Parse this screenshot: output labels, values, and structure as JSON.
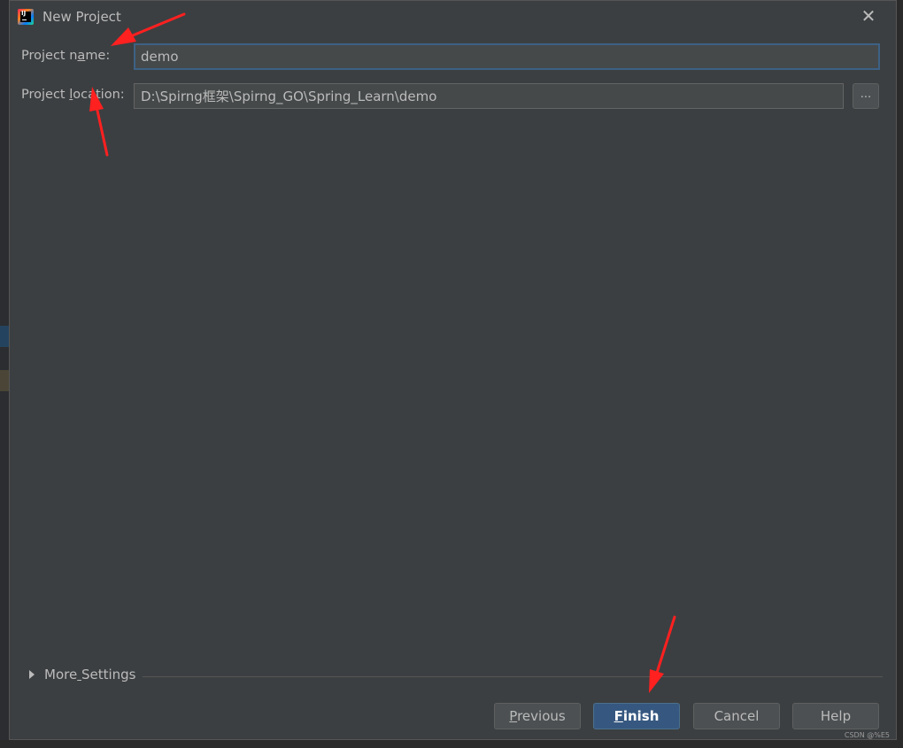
{
  "window": {
    "title": "New Project",
    "close_icon": "close-icon"
  },
  "form": {
    "project_name_label_pre": "Project n",
    "project_name_label_mnemonic": "a",
    "project_name_label_post": "me:",
    "project_name_value": "demo",
    "project_location_label_pre": "Project ",
    "project_location_label_mnemonic": "l",
    "project_location_label_post": "ocation:",
    "project_location_value": "D:\\Spirng框架\\Spirng_GO\\Spring_Learn\\demo",
    "browse_label": "..."
  },
  "more_settings": {
    "label_pre": "More",
    "label_mnemonic": " ",
    "label_post": "Settings",
    "expanded": false
  },
  "buttons": {
    "previous_mnemonic": "P",
    "previous_rest": "revious",
    "finish_mnemonic": "F",
    "finish_rest": "inish",
    "cancel": "Cancel",
    "help": "Help"
  },
  "watermark": "CSDN @%E5",
  "colors": {
    "dialog_bg": "#3c3f41",
    "input_bg": "#45494a",
    "focus_border": "#3d6185",
    "primary_button": "#365880",
    "annotation_arrow": "#ff2020"
  }
}
